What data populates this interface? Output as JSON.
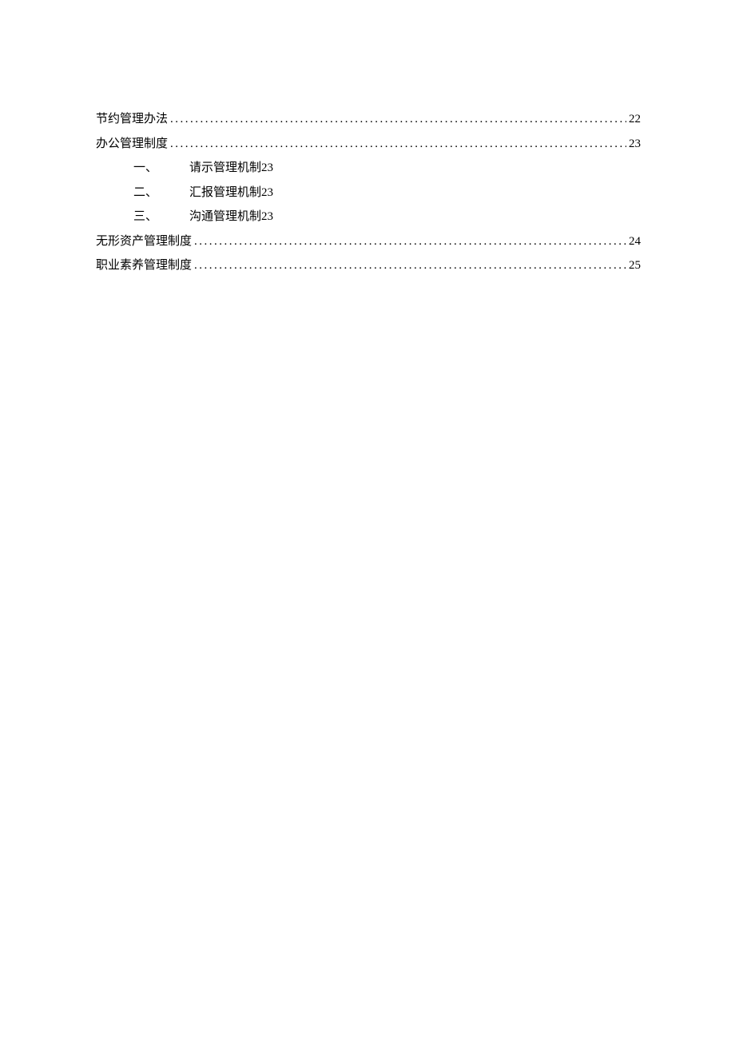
{
  "toc": [
    {
      "title": "节约管理办法",
      "page": "22",
      "subs": []
    },
    {
      "title": "办公管理制度",
      "page": "23",
      "subs": [
        {
          "marker": "一、",
          "text": "请示管理机制23"
        },
        {
          "marker": "二、",
          "text": "汇报管理机制23"
        },
        {
          "marker": "三、",
          "text": "沟通管理机制23"
        }
      ]
    },
    {
      "title": "无形资产管理制度",
      "page": "24",
      "subs": []
    },
    {
      "title": "职业素养管理制度",
      "page": "25",
      "subs": []
    }
  ]
}
